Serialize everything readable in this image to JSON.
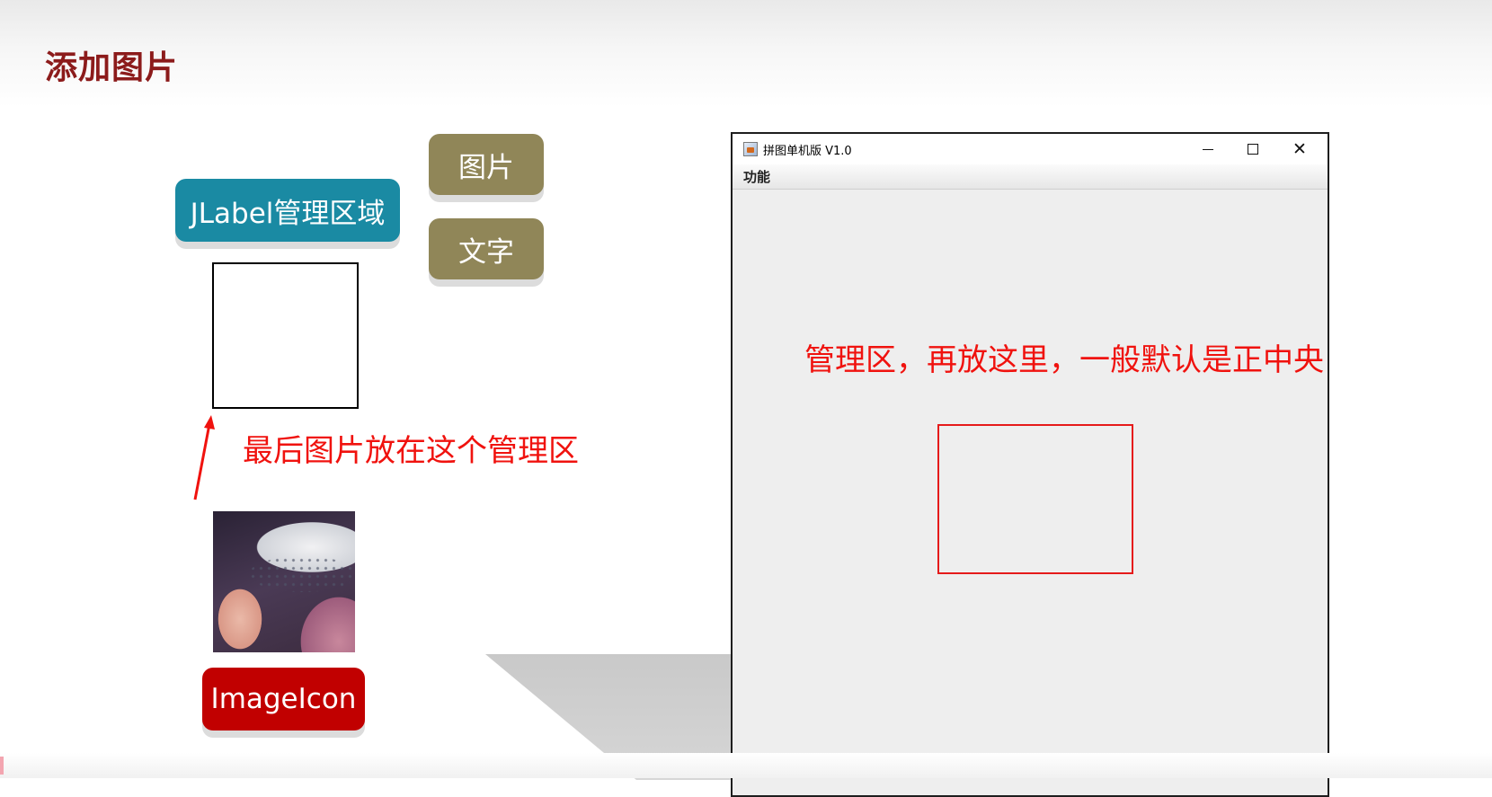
{
  "slide": {
    "title": "添加图片",
    "jlabel_tag": "JLabel管理区域",
    "image_tag": "图片",
    "text_tag": "文字",
    "imageicon_tag": "ImageIcon",
    "note_left": "最后图片放在这个管理区",
    "note_right": "管理区，再放这里，一般默认是正中央"
  },
  "window": {
    "title": "拼图单机版 V1.0",
    "menu": [
      "功能"
    ],
    "icons": {
      "app": "java-app-icon",
      "minimize": "minimize-icon",
      "maximize": "maximize-icon",
      "close": "close-icon"
    },
    "close_glyph": "✕"
  },
  "colors": {
    "title": "#8c1b1b",
    "teal": "#1a8aa3",
    "olive": "#908658",
    "red_tag": "#c10000",
    "annotation": "#f0120e"
  }
}
